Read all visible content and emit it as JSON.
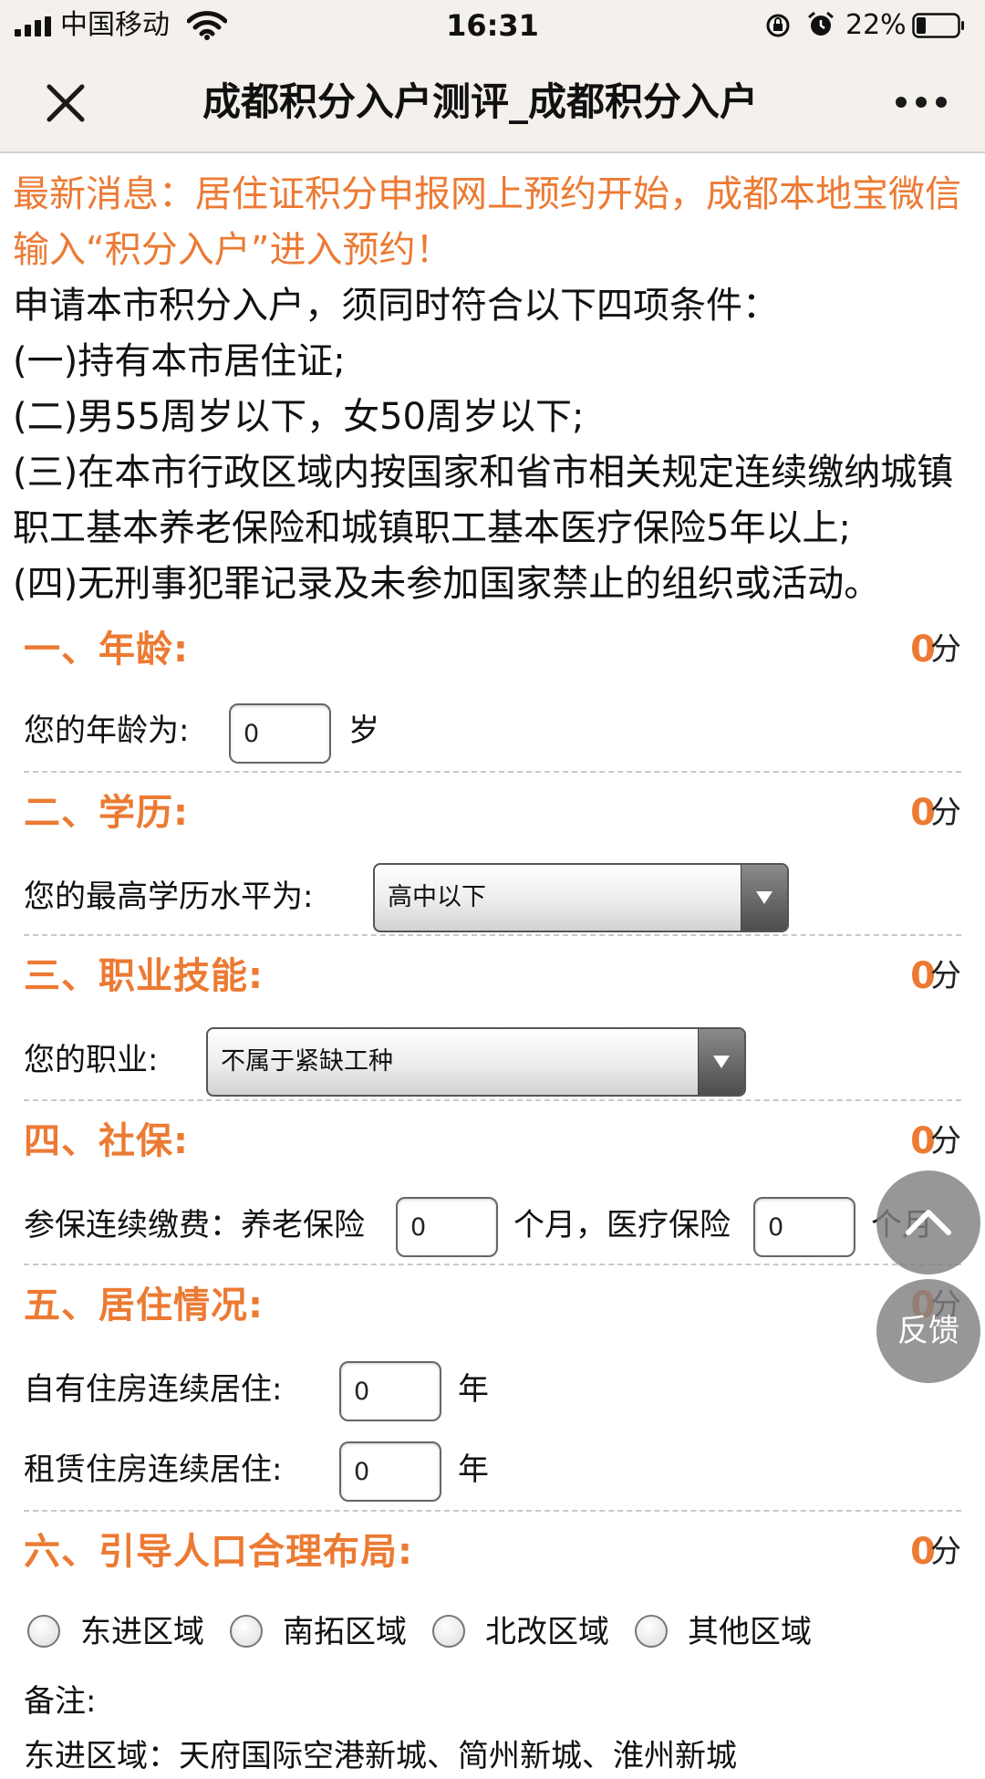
{
  "status_bar": {
    "carrier": "中国移动",
    "time": "16:31",
    "battery": "22%",
    "battery_level": 0.22
  },
  "nav": {
    "title": "成都积分入户测评_成都积分入户",
    "close_icon": "close-icon",
    "more_icon": "more-icon"
  },
  "notice": {
    "news": "最新消息：居住证积分申报网上预约开始，成都本地宝微信输入“积分入户”进入预约！",
    "intro": "申请本市积分入户，须同时符合以下四项条件：",
    "conditions": [
      "(一)持有本市居住证;",
      "(二)男55周岁以下，女50周岁以下;",
      "(三)在本市行政区域内按国家和省市相关规定连续缴纳城镇职工基本养老保险和城镇职工基本医疗保险5年以上;",
      "(四)无刑事犯罪记录及未参加国家禁止的组织或活动。"
    ]
  },
  "score_unit": "分",
  "sections": {
    "age": {
      "title": "一、年龄:",
      "score": "0",
      "label": "您的年龄为:",
      "value": "0",
      "unit": "岁"
    },
    "education": {
      "title": "二、学历:",
      "score": "0",
      "label": "您的最高学历水平为:",
      "selected": "高中以下"
    },
    "skill": {
      "title": "三、职业技能:",
      "score": "0",
      "label": "您的职业:",
      "selected": "不属于紧缺工种"
    },
    "social": {
      "title": "四、社保:",
      "score": "0",
      "label": "参保连续缴费：养老保险",
      "pension_value": "0",
      "middle": "个月，医疗保险",
      "medical_value": "0",
      "unit": "个月"
    },
    "residence": {
      "title": "五、居住情况:",
      "score": "0",
      "own_label": "自有住房连续居住:",
      "own_value": "0",
      "rent_label": "租赁住房连续居住:",
      "rent_value": "0",
      "unit": "年"
    },
    "layout": {
      "title": "六、引导人口合理布局:",
      "score": "0",
      "options": [
        "东进区域",
        "南拓区域",
        "北改区域",
        "其他区域"
      ],
      "note_label": "备注:",
      "note_partial": "东进区域：天府国际空港新城、简州新城、淮州新城"
    }
  },
  "floating": {
    "up_icon": "chevron-up-icon",
    "feedback": "反馈"
  }
}
